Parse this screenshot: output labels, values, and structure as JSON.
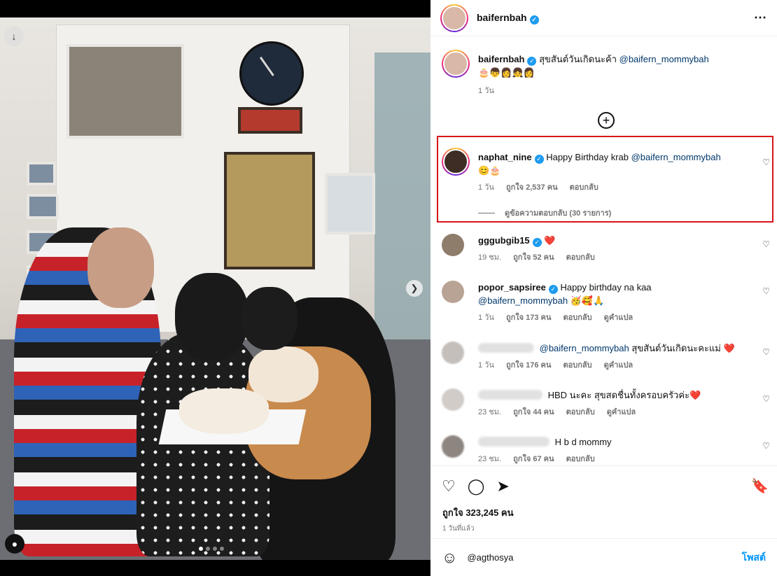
{
  "post": {
    "username": "baifernbah",
    "more_icon": "more-horizontal-icon",
    "likes_text": "ถูกใจ 323,245 คน",
    "time_ago": "1 วันที่แล้ว"
  },
  "caption": {
    "username": "baifernbah",
    "text": "สุขสันต์วันเกิดนะค้า",
    "mention": "@baifern_mommybah",
    "emojis": "🎂👦👩👧👩",
    "time": "1 วัน"
  },
  "comments": [
    {
      "username": "naphat_nine",
      "text": "Happy Birthday krab",
      "mention": "@baifern_mommybah",
      "emojis": "😊🎂",
      "time": "1 วัน",
      "likes": "ถูกใจ 2,537 คน",
      "reply": "ตอบกลับ",
      "view_replies": "ดูข้อความตอบกลับ (30 รายการ)"
    },
    {
      "username": "gggubgib15",
      "text": "",
      "emojis": "❤️",
      "time": "19 ชม.",
      "likes": "ถูกใจ 52 คน",
      "reply": "ตอบกลับ"
    },
    {
      "username": "popor_sapsiree",
      "text": "Happy birthday na kaa",
      "mention": "@baifern_mommybah",
      "emojis": "🥳🥰🙏",
      "time": "1 วัน",
      "likes": "ถูกใจ 173 คน",
      "reply": "ตอบกลับ",
      "translate": "ดูคำแปล"
    },
    {
      "username": "",
      "mention": "@baifern_mommybah",
      "text": "สุขสันต์วันเกิดนะคะแม่",
      "emojis": "❤️",
      "time": "1 วัน",
      "likes": "ถูกใจ 176 คน",
      "reply": "ตอบกลับ",
      "translate": "ดูคำแปล"
    },
    {
      "username": "",
      "text": "HBD นะคะ สุขสดชื่นทั้งครอบครัวค่ะ",
      "emojis": "❤️",
      "time": "23 ชม.",
      "likes": "ถูกใจ 44 คน",
      "reply": "ตอบกลับ",
      "translate": "ดูคำแปล"
    },
    {
      "username": "",
      "text": "H b d mommy",
      "time": "23 ชม.",
      "likes": "ถูกใจ 67 คน",
      "reply": "ตอบกลับ"
    }
  ],
  "composer": {
    "emoji_icon": "smiley-icon",
    "input_value": "@agthosya",
    "post_label": "โพสต์"
  },
  "colors": {
    "accent": "#0095f6",
    "highlight": "#d8141b",
    "verified": "#1d9bf0"
  }
}
